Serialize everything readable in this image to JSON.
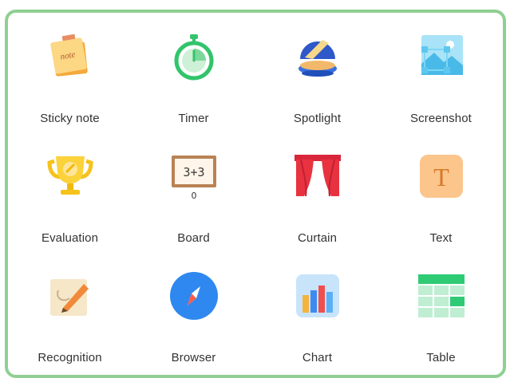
{
  "tools": [
    {
      "label": "Sticky note",
      "icon": "sticky-note-icon"
    },
    {
      "label": "Timer",
      "icon": "timer-icon"
    },
    {
      "label": "Spotlight",
      "icon": "spotlight-icon"
    },
    {
      "label": "Screenshot",
      "icon": "screenshot-icon"
    },
    {
      "label": "Evaluation",
      "icon": "trophy-icon"
    },
    {
      "label": "Board",
      "icon": "board-icon"
    },
    {
      "label": "Curtain",
      "icon": "curtain-icon"
    },
    {
      "label": "Text",
      "icon": "text-icon"
    },
    {
      "label": "Recognition",
      "icon": "recognition-icon"
    },
    {
      "label": "Browser",
      "icon": "compass-icon"
    },
    {
      "label": "Chart",
      "icon": "bar-chart-icon"
    },
    {
      "label": "Table",
      "icon": "table-icon"
    }
  ],
  "icon_text": {
    "sticky_note": "note",
    "board": "3+3",
    "board_sub": "0",
    "text_glyph": "T"
  },
  "colors": {
    "panel_border": "#8fcf93",
    "accent_green": "#3fb34f"
  }
}
